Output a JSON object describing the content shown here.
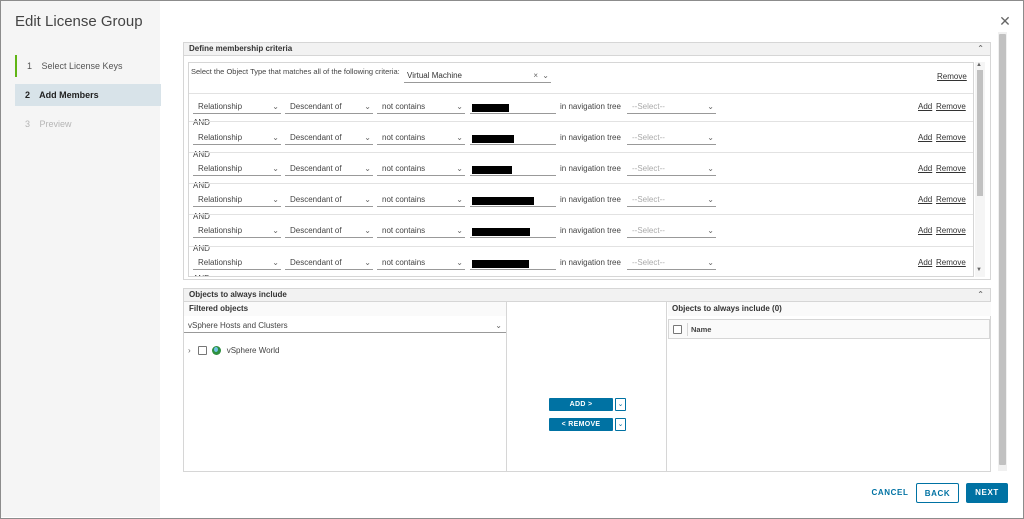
{
  "wizard": {
    "title": "Edit License Group",
    "steps": [
      {
        "num": "1",
        "label": "Select License Keys"
      },
      {
        "num": "2",
        "label": "Add Members"
      },
      {
        "num": "3",
        "label": "Preview"
      }
    ]
  },
  "criteria": {
    "header": "Define membership criteria",
    "object_type_label": "Select the Object Type that matches all of the following criteria:",
    "object_type_value": "Virtual Machine",
    "remove_label": "Remove",
    "and_label": "AND",
    "rows": [
      {
        "relationship": "Relationship",
        "descendant": "Descendant of",
        "condition": "not contains",
        "nav_label": "in navigation tree",
        "nav_placeholder": "--Select--",
        "add": "Add",
        "remove": "Remove"
      },
      {
        "relationship": "Relationship",
        "descendant": "Descendant of",
        "condition": "not contains",
        "nav_label": "in navigation tree",
        "nav_placeholder": "--Select--",
        "add": "Add",
        "remove": "Remove"
      },
      {
        "relationship": "Relationship",
        "descendant": "Descendant of",
        "condition": "not contains",
        "nav_label": "in navigation tree",
        "nav_placeholder": "--Select--",
        "add": "Add",
        "remove": "Remove"
      },
      {
        "relationship": "Relationship",
        "descendant": "Descendant of",
        "condition": "not contains",
        "nav_label": "in navigation tree",
        "nav_placeholder": "--Select--",
        "add": "Add",
        "remove": "Remove"
      },
      {
        "relationship": "Relationship",
        "descendant": "Descendant of",
        "condition": "not contains",
        "nav_label": "in navigation tree",
        "nav_placeholder": "--Select--",
        "add": "Add",
        "remove": "Remove"
      },
      {
        "relationship": "Relationship",
        "descendant": "Descendant of",
        "condition": "not contains",
        "nav_label": "in navigation tree",
        "nav_placeholder": "--Select--",
        "add": "Add",
        "remove": "Remove"
      }
    ]
  },
  "include": {
    "header": "Objects to always include",
    "filtered_title": "Filtered objects",
    "filter_value": "vSphere Hosts and Clusters",
    "tree_item": "vSphere World",
    "add_button": "ADD >",
    "remove_button": "< REMOVE",
    "right_title": "Objects to always include (0)",
    "column_name": "Name"
  },
  "footer": {
    "cancel": "CANCEL",
    "back": "BACK",
    "next": "NEXT"
  },
  "colors": {
    "accent": "#0072a3",
    "active_step_bar": "#60b515",
    "active_step_bg": "#d8e3e9"
  }
}
